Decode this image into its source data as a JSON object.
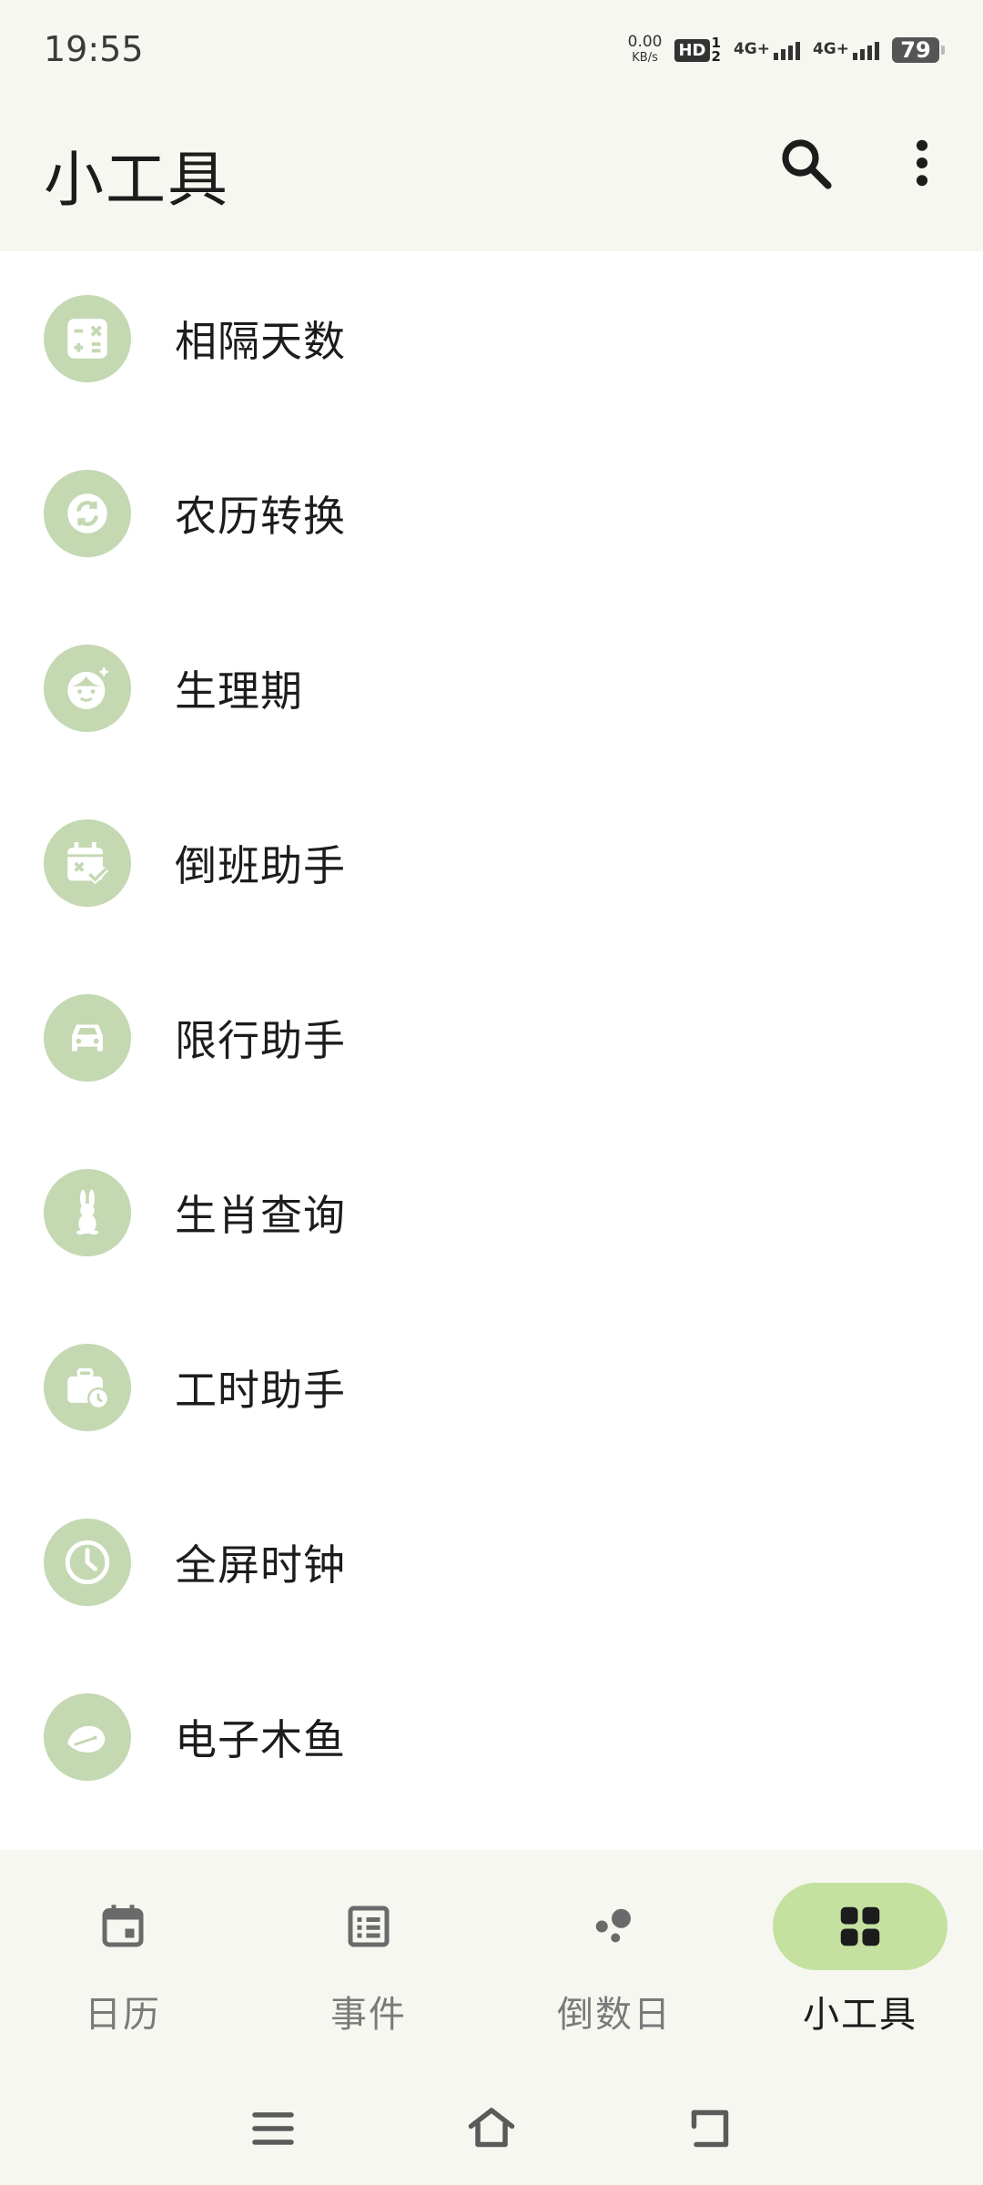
{
  "status_bar": {
    "time": "19:55",
    "net_speed_value": "0.00",
    "net_speed_unit": "KB/s",
    "hd_label": "HD",
    "hd_sim_top": "1",
    "hd_sim_bottom": "2",
    "signal1_label": "4G+",
    "signal2_label": "4G+",
    "battery_level": "79"
  },
  "app_bar": {
    "title": "小工具",
    "search_icon": "search-icon",
    "more_icon": "more-vertical-icon"
  },
  "tools": [
    {
      "label": "相隔天数",
      "icon": "calculator-icon"
    },
    {
      "label": "农历转换",
      "icon": "sync-icon"
    },
    {
      "label": "生理期",
      "icon": "girl-face-icon"
    },
    {
      "label": "倒班助手",
      "icon": "calendar-check-icon"
    },
    {
      "label": "限行助手",
      "icon": "car-icon"
    },
    {
      "label": "生肖查询",
      "icon": "rabbit-icon"
    },
    {
      "label": "工时助手",
      "icon": "briefcase-clock-icon"
    },
    {
      "label": "全屏时钟",
      "icon": "clock-icon"
    },
    {
      "label": "电子木鱼",
      "icon": "wooden-fish-icon"
    }
  ],
  "bottom_nav": [
    {
      "label": "日历",
      "icon": "calendar-icon",
      "active": false
    },
    {
      "label": "事件",
      "icon": "list-icon",
      "active": false
    },
    {
      "label": "倒数日",
      "icon": "bubbles-icon",
      "active": false
    },
    {
      "label": "小工具",
      "icon": "grid-icon",
      "active": true
    }
  ],
  "colors": {
    "icon_circle": "#c4d8b2",
    "active_pill": "#c4e19f",
    "bar_background": "#f5f7f0",
    "inactive_text": "#7a7a7a"
  }
}
